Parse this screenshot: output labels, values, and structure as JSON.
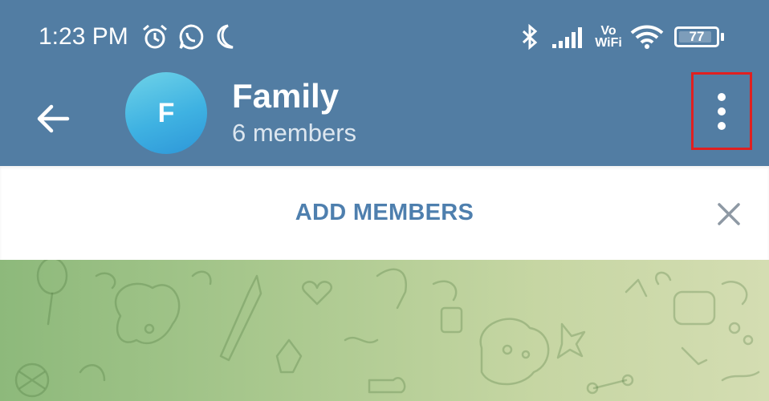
{
  "status_bar": {
    "time": "1:23 PM",
    "icons": [
      "alarm-icon",
      "whatsapp-icon",
      "moon-icon",
      "bluetooth-icon",
      "signal-icon",
      "vowifi-icon",
      "wifi-icon",
      "battery-icon"
    ],
    "vowifi_top": "Vo",
    "vowifi_bottom": "WiFi",
    "battery_level": "77"
  },
  "chat_header": {
    "avatar_letter": "F",
    "title": "Family",
    "subtitle": "6 members"
  },
  "banner": {
    "label": "ADD MEMBERS"
  },
  "colors": {
    "header": "#527DA3",
    "accent": "#4E7FAE",
    "highlight": "#E02020"
  }
}
